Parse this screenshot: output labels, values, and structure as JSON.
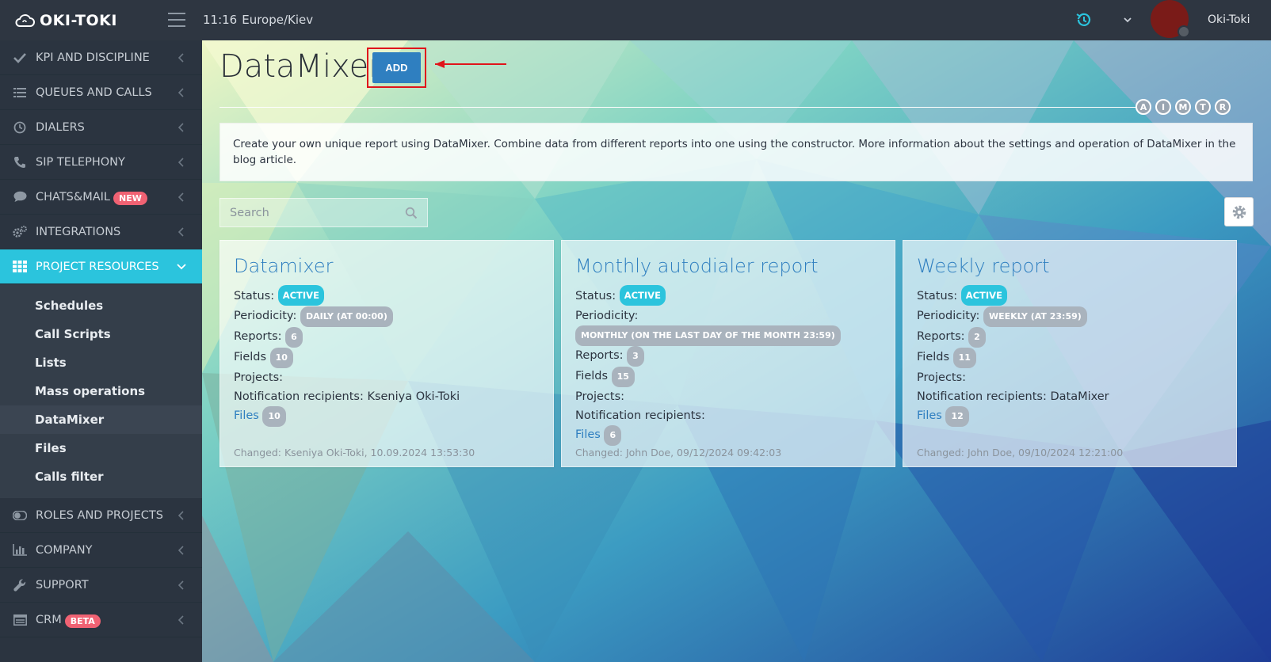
{
  "header": {
    "brand": "OKI-TOKI",
    "time": "11:16",
    "timezone": "Europe/Kiev",
    "username": "Oki-Toki"
  },
  "sidebar": {
    "items_top": [
      {
        "label": "KPI AND DISCIPLINE",
        "icon": "check-icon"
      },
      {
        "label": "QUEUES AND CALLS",
        "icon": "list-icon"
      },
      {
        "label": "DIALERS",
        "icon": "clock-icon"
      },
      {
        "label": "SIP TELEPHONY",
        "icon": "phone-icon"
      },
      {
        "label": "CHATS&MAIL",
        "icon": "chat-icon",
        "badge": "NEW"
      },
      {
        "label": "INTEGRATIONS",
        "icon": "cogs-icon"
      },
      {
        "label": "PROJECT RESOURCES",
        "icon": "grid-icon"
      }
    ],
    "submenu": [
      "Schedules",
      "Call Scripts",
      "Lists",
      "Mass operations",
      "DataMixer",
      "Files",
      "Calls filter"
    ],
    "items_bottom": [
      {
        "label": "ROLES AND PROJECTS",
        "icon": "toggle-icon"
      },
      {
        "label": "COMPANY",
        "icon": "bar-chart-icon"
      },
      {
        "label": "SUPPORT",
        "icon": "wrench-icon"
      },
      {
        "label": "CRM",
        "icon": "table-icon",
        "badge": "BETA"
      }
    ]
  },
  "main": {
    "title": "DataMixer",
    "add_label": "ADD",
    "circles": [
      "A",
      "I",
      "M",
      "T",
      "R"
    ],
    "info": "Create your own unique report using DataMixer. Combine data from different reports into one using the constructor. More information about the settings and operation of DataMixer in the blog article.",
    "search_placeholder": "Search",
    "labels": {
      "status": "Status:",
      "periodicity": "Periodicity:",
      "reports": "Reports:",
      "fields": "Fields",
      "projects": "Projects:",
      "recipients": "Notification recipients:",
      "files": "Files"
    },
    "cards": [
      {
        "title": "Datamixer",
        "status": "ACTIVE",
        "periodicity": "DAILY (AT 00:00)",
        "reports": "6",
        "fields": "10",
        "recipients": "Kseniya Oki-Toki",
        "files": "10",
        "changed": "Changed: Kseniya Oki-Toki, 10.09.2024 13:53:30"
      },
      {
        "title": "Monthly autodialer report",
        "status": "ACTIVE",
        "periodicity": "MONTHLY (ON THE LAST DAY OF THE MONTH 23:59)",
        "reports": "3",
        "fields": "15",
        "recipients": "",
        "files": "6",
        "changed": "Changed: John Doe, 09/12/2024 09:42:03"
      },
      {
        "title": "Weekly report",
        "status": "ACTIVE",
        "periodicity": "WEEKLY (AT 23:59)",
        "reports": "2",
        "fields": "11",
        "recipients": "DataMixer",
        "files": "12",
        "changed": "Changed: John Doe, 09/10/2024 12:21:00"
      }
    ]
  }
}
